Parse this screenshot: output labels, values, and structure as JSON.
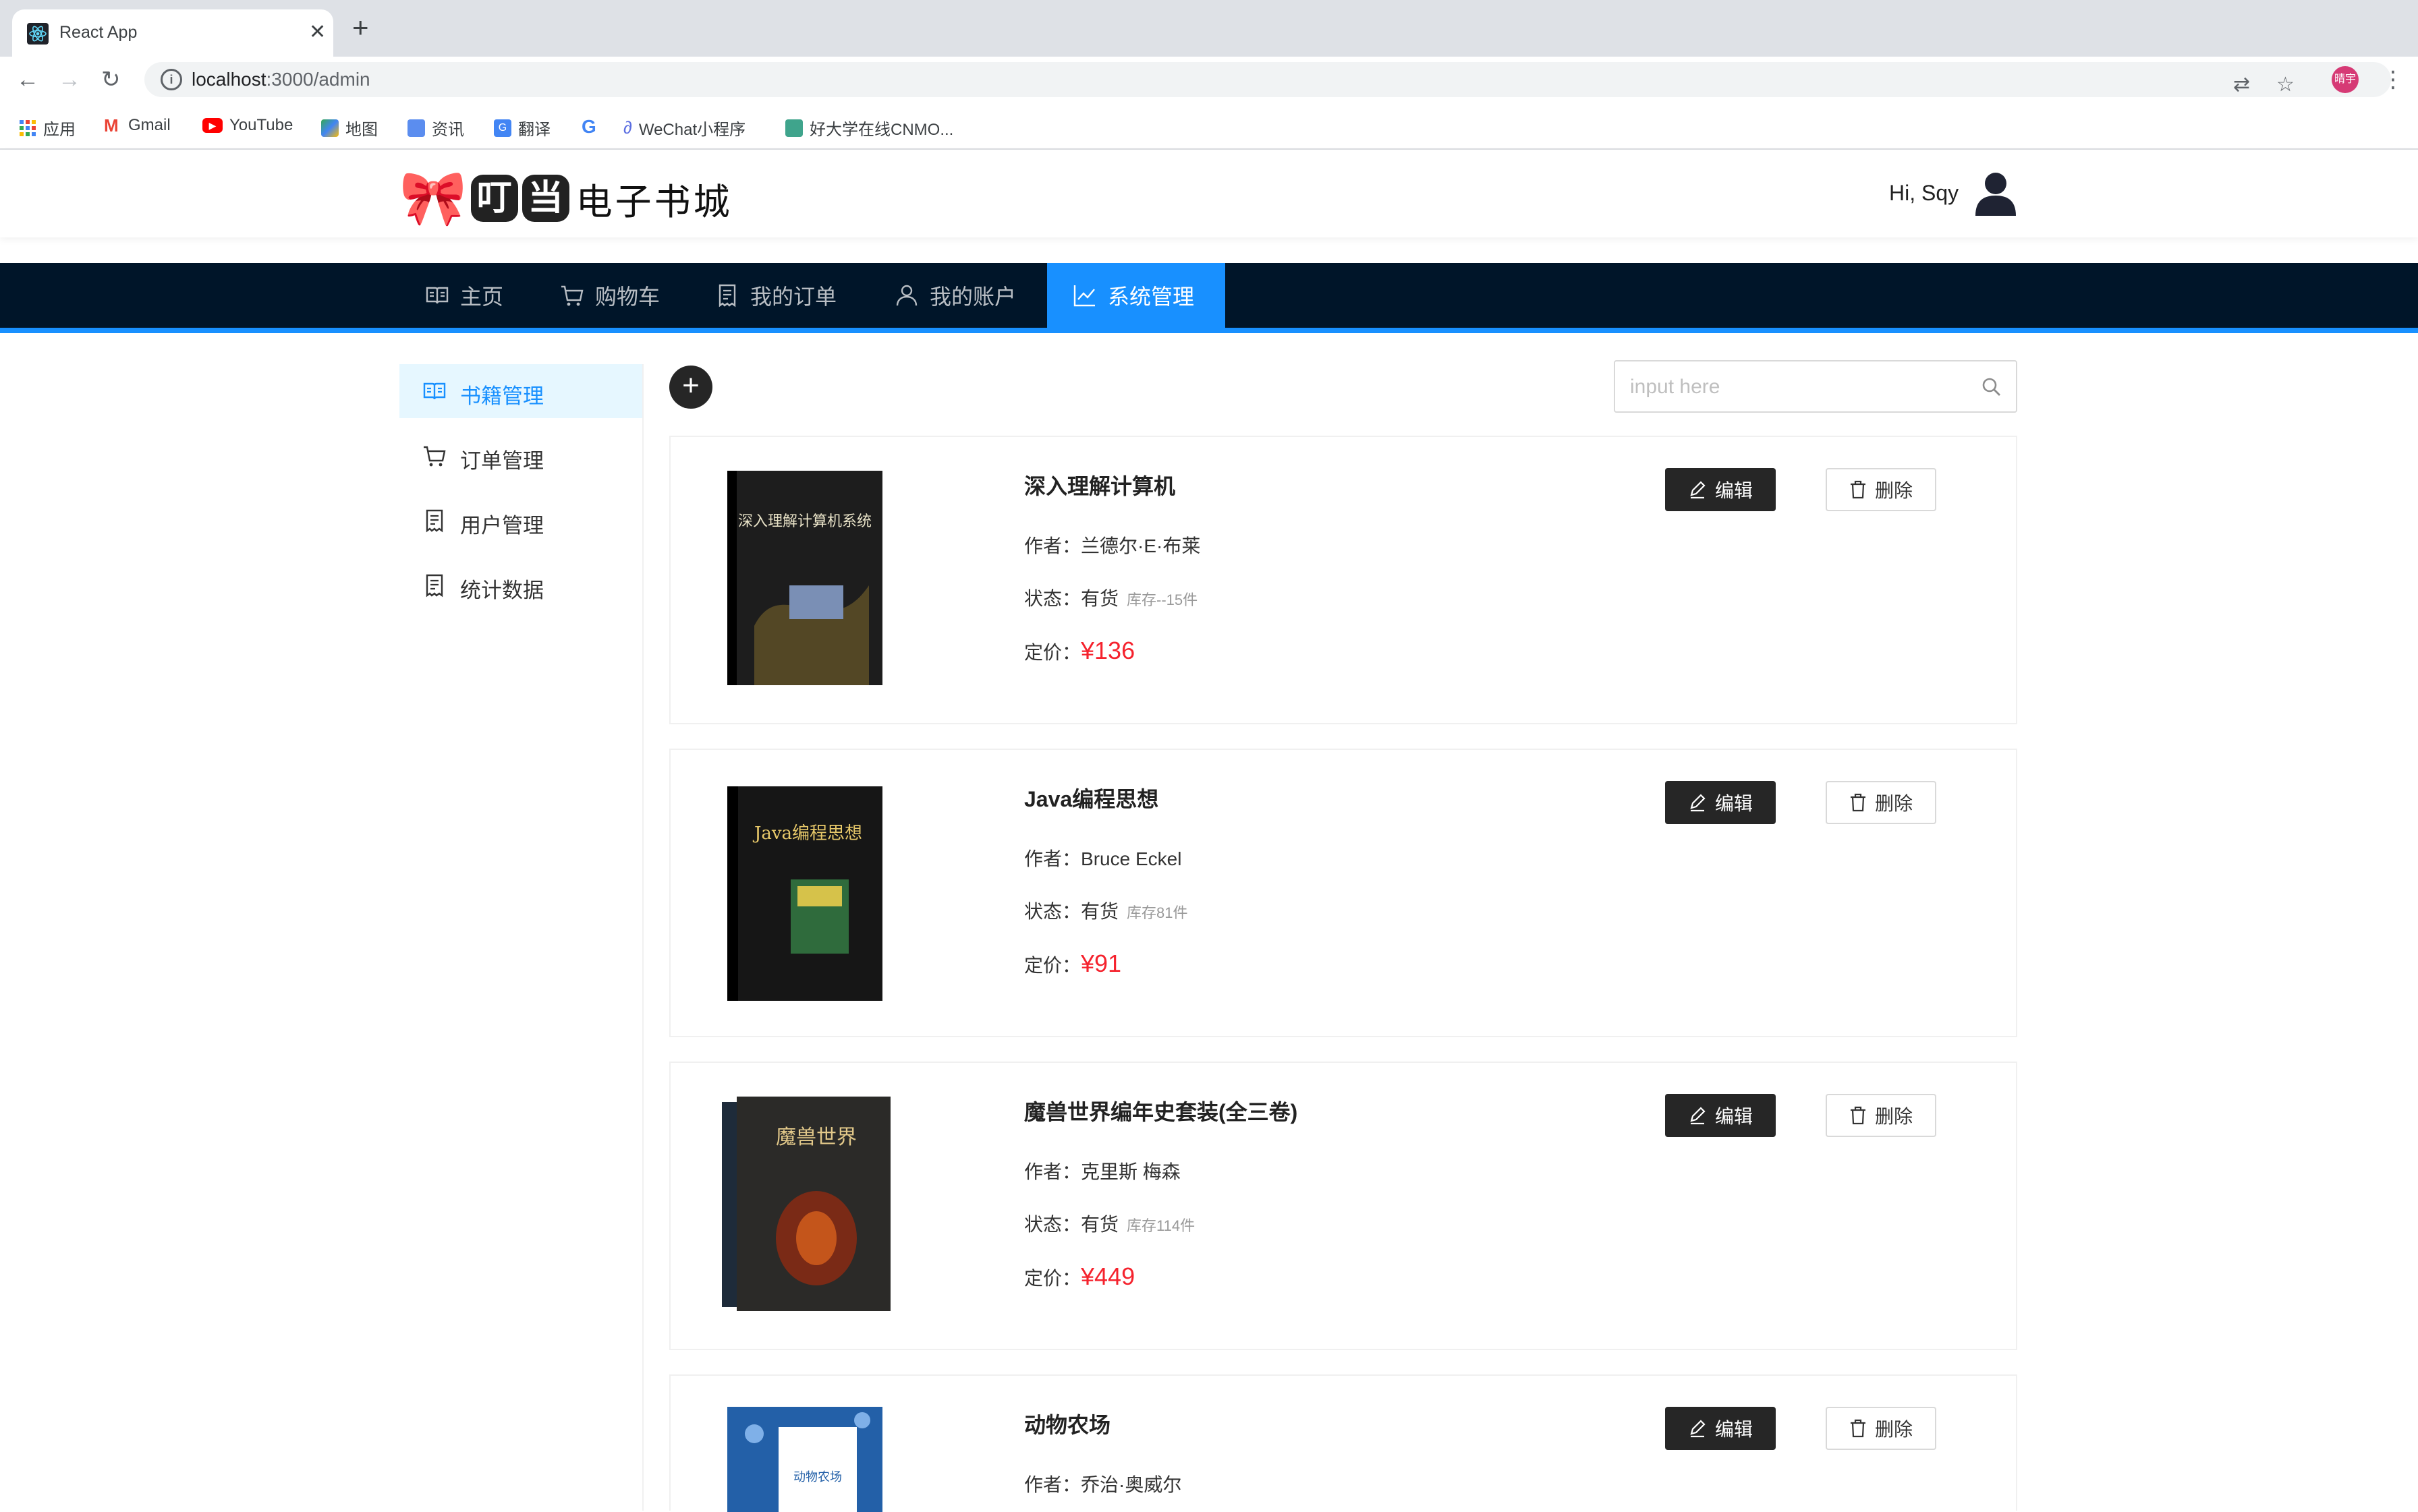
{
  "browser": {
    "tab_title": "React App",
    "url_host": "localhost",
    "url_rest": ":3000/admin",
    "profile_label": "晴宇",
    "bookmarks": [
      "应用",
      "Gmail",
      "YouTube",
      "地图",
      "资讯",
      "翻译",
      "",
      "WeChat小程序",
      "好大学在线CNMO..."
    ]
  },
  "header": {
    "logo_bell": "🎀",
    "logo_block1": "叮",
    "logo_block2": "当",
    "logo_rest": "电子书城",
    "greeting": "Hi, Sqy"
  },
  "nav": {
    "items": [
      {
        "label": "主页",
        "icon": "book-icon"
      },
      {
        "label": "购物车",
        "icon": "cart-icon"
      },
      {
        "label": "我的订单",
        "icon": "order-icon"
      },
      {
        "label": "我的账户",
        "icon": "user-icon"
      },
      {
        "label": "系统管理",
        "icon": "chart-icon"
      }
    ],
    "active_index": 4
  },
  "sidebar": {
    "items": [
      {
        "label": "书籍管理",
        "icon": "book-icon"
      },
      {
        "label": "订单管理",
        "icon": "cart-icon"
      },
      {
        "label": "用户管理",
        "icon": "file-icon"
      },
      {
        "label": "统计数据",
        "icon": "file-icon"
      }
    ],
    "active_index": 0
  },
  "toolbar": {
    "add_label": "+",
    "search_placeholder": "input here"
  },
  "labels": {
    "author": "作者：",
    "status": "状态：",
    "price": "定价：",
    "edit": "编辑",
    "delete": "删除"
  },
  "books": [
    {
      "title": "深入理解计算机",
      "author": "兰德尔·E·布莱",
      "status": "有货",
      "stock": "库存--15件",
      "price": "¥136",
      "cover_color": "#1d1d1d",
      "cover_text": "深入理解计算机系统"
    },
    {
      "title": "Java编程思想",
      "author": "Bruce Eckel",
      "status": "有货",
      "stock": "库存81件",
      "price": "¥91",
      "cover_color": "#161616",
      "cover_text": "Java编程思想"
    },
    {
      "title": "魔兽世界编年史套装(全三卷)",
      "author": "克里斯 梅森",
      "status": "有货",
      "stock": "库存114件",
      "price": "¥449",
      "cover_color": "#2b2a28",
      "cover_text": "魔兽世界"
    },
    {
      "title": "动物农场",
      "author": "乔治·奥威尔",
      "status": "",
      "stock": "",
      "price": "",
      "cover_color": "#2360a8",
      "cover_text": "动物农场"
    }
  ]
}
